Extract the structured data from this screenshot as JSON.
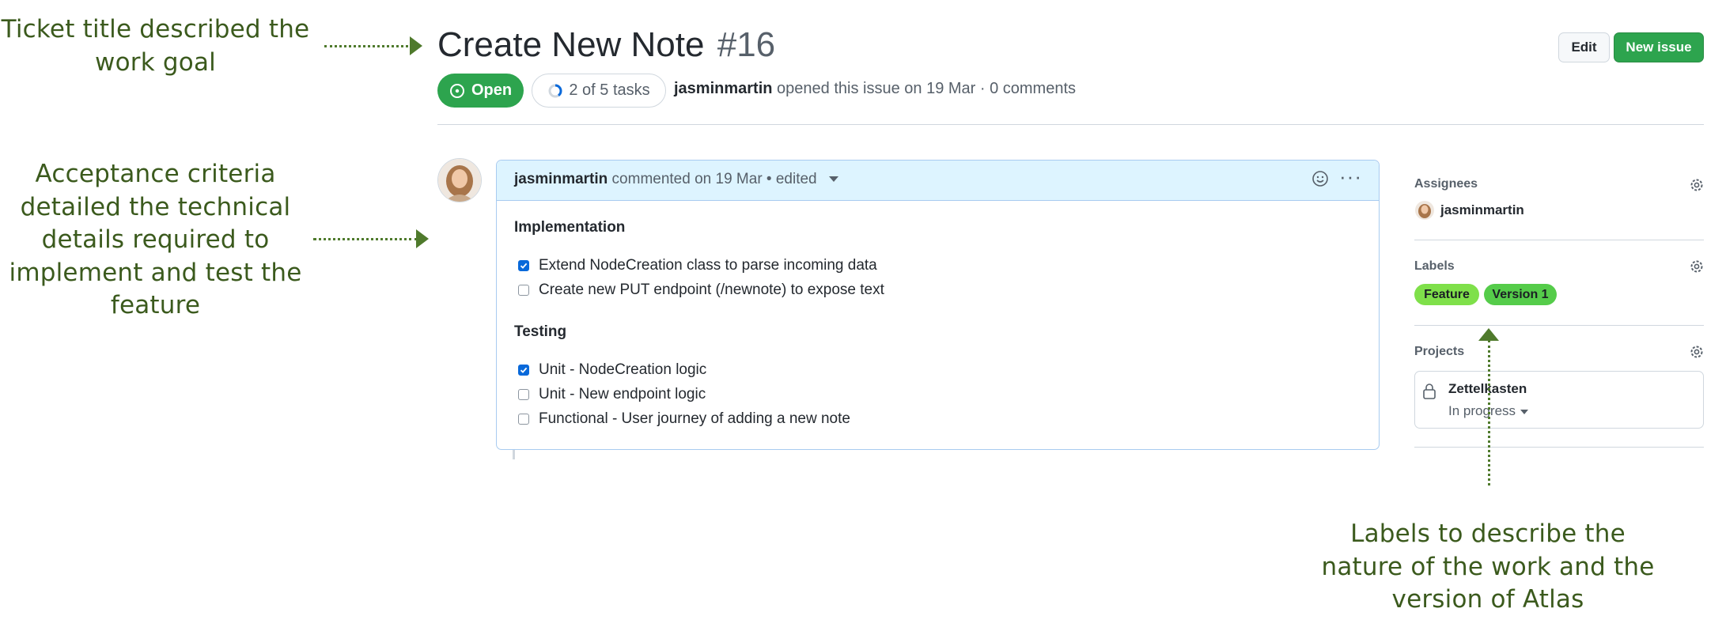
{
  "annotations": {
    "title_note": [
      "Ticket title described the",
      "work goal"
    ],
    "criteria_note": [
      "Acceptance criteria",
      "detailed the technical",
      "details required to",
      "implement and test the",
      "feature"
    ],
    "labels_note": [
      "Labels to describe the",
      "nature of the work and the",
      "version of Atlas"
    ]
  },
  "issue": {
    "title": "Create New Note",
    "number": "#16",
    "state": "Open",
    "tasks_progress": "2 of 5 tasks",
    "tasks_done": 2,
    "tasks_total": 5,
    "author": "jasminmartin",
    "opened_text": "opened this issue on 19 Mar · 0 comments"
  },
  "toolbar": {
    "edit_label": "Edit",
    "new_issue_label": "New issue"
  },
  "comment": {
    "author": "jasminmartin",
    "meta": "commented on 19 Mar • edited",
    "sections": [
      {
        "heading": "Implementation",
        "tasks": [
          {
            "text": "Extend NodeCreation class to parse incoming data",
            "checked": true
          },
          {
            "text": "Create new PUT endpoint (/newnote) to expose text",
            "checked": false
          }
        ]
      },
      {
        "heading": "Testing",
        "tasks": [
          {
            "text": "Unit - NodeCreation logic",
            "checked": true
          },
          {
            "text": "Unit - New endpoint logic",
            "checked": false
          },
          {
            "text": "Functional - User journey of adding a new note",
            "checked": false
          }
        ]
      }
    ]
  },
  "sidebar": {
    "assignees_heading": "Assignees",
    "assignee_name": "jasminmartin",
    "labels_heading": "Labels",
    "labels": [
      {
        "name": "Feature",
        "color": "#7fe04a"
      },
      {
        "name": "Version 1",
        "color": "#55cc4a"
      }
    ],
    "projects_heading": "Projects",
    "project_name": "Zettelkasten",
    "project_status": "In progress"
  },
  "colors": {
    "accent_green": "#2da44e",
    "annotation_green": "#3b5a1d",
    "comment_header_bg": "#ddf4ff",
    "checkbox_blue": "#0969da"
  }
}
